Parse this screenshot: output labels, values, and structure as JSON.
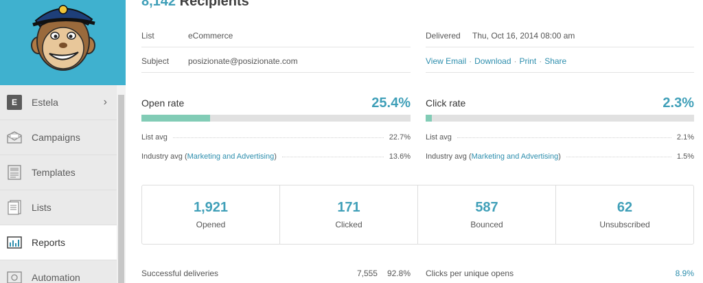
{
  "sidebar": {
    "account": {
      "badge": "E",
      "label": "Estela"
    },
    "items": [
      {
        "label": "Campaigns",
        "icon": "envelope-icon"
      },
      {
        "label": "Templates",
        "icon": "template-icon"
      },
      {
        "label": "Lists",
        "icon": "list-icon"
      },
      {
        "label": "Reports",
        "icon": "bar-chart-icon",
        "active": true
      },
      {
        "label": "Automation",
        "icon": "automation-icon"
      }
    ]
  },
  "header": {
    "recipients_count": "8,142",
    "recipients_label": "Recipients"
  },
  "details": {
    "list_label": "List",
    "list_value": "eCommerce",
    "subject_label": "Subject",
    "subject_value": "posizionate@posizionate.com",
    "delivered_label": "Delivered",
    "delivered_value": "Thu, Oct 16, 2014 08:00 am",
    "actions": [
      "View Email",
      "Download",
      "Print",
      "Share"
    ]
  },
  "open_rate": {
    "title": "Open rate",
    "value": "25.4%",
    "fill_percent": 25.4,
    "list_avg_label": "List avg",
    "list_avg_value": "22.7%",
    "industry_prefix": "Industry avg (",
    "industry_link": "Marketing and Advertising",
    "industry_suffix": ")",
    "industry_value": "13.6%"
  },
  "click_rate": {
    "title": "Click rate",
    "value": "2.3%",
    "fill_percent": 2.3,
    "list_avg_label": "List avg",
    "list_avg_value": "2.1%",
    "industry_prefix": "Industry avg (",
    "industry_link": "Marketing and Advertising",
    "industry_suffix": ")",
    "industry_value": "1.5%"
  },
  "stats": [
    {
      "number": "1,921",
      "label": "Opened"
    },
    {
      "number": "171",
      "label": "Clicked"
    },
    {
      "number": "587",
      "label": "Bounced"
    },
    {
      "number": "62",
      "label": "Unsubscribed"
    }
  ],
  "bottom": {
    "deliveries_label": "Successful deliveries",
    "deliveries_count": "7,555",
    "deliveries_percent": "92.8%",
    "clicks_label": "Clicks per unique opens",
    "clicks_value": "8.9%"
  },
  "colors": {
    "brand": "#3fb1cf",
    "accent": "#3f9fb8",
    "bar_fill": "#82ccb6",
    "link": "#2d8ead"
  }
}
